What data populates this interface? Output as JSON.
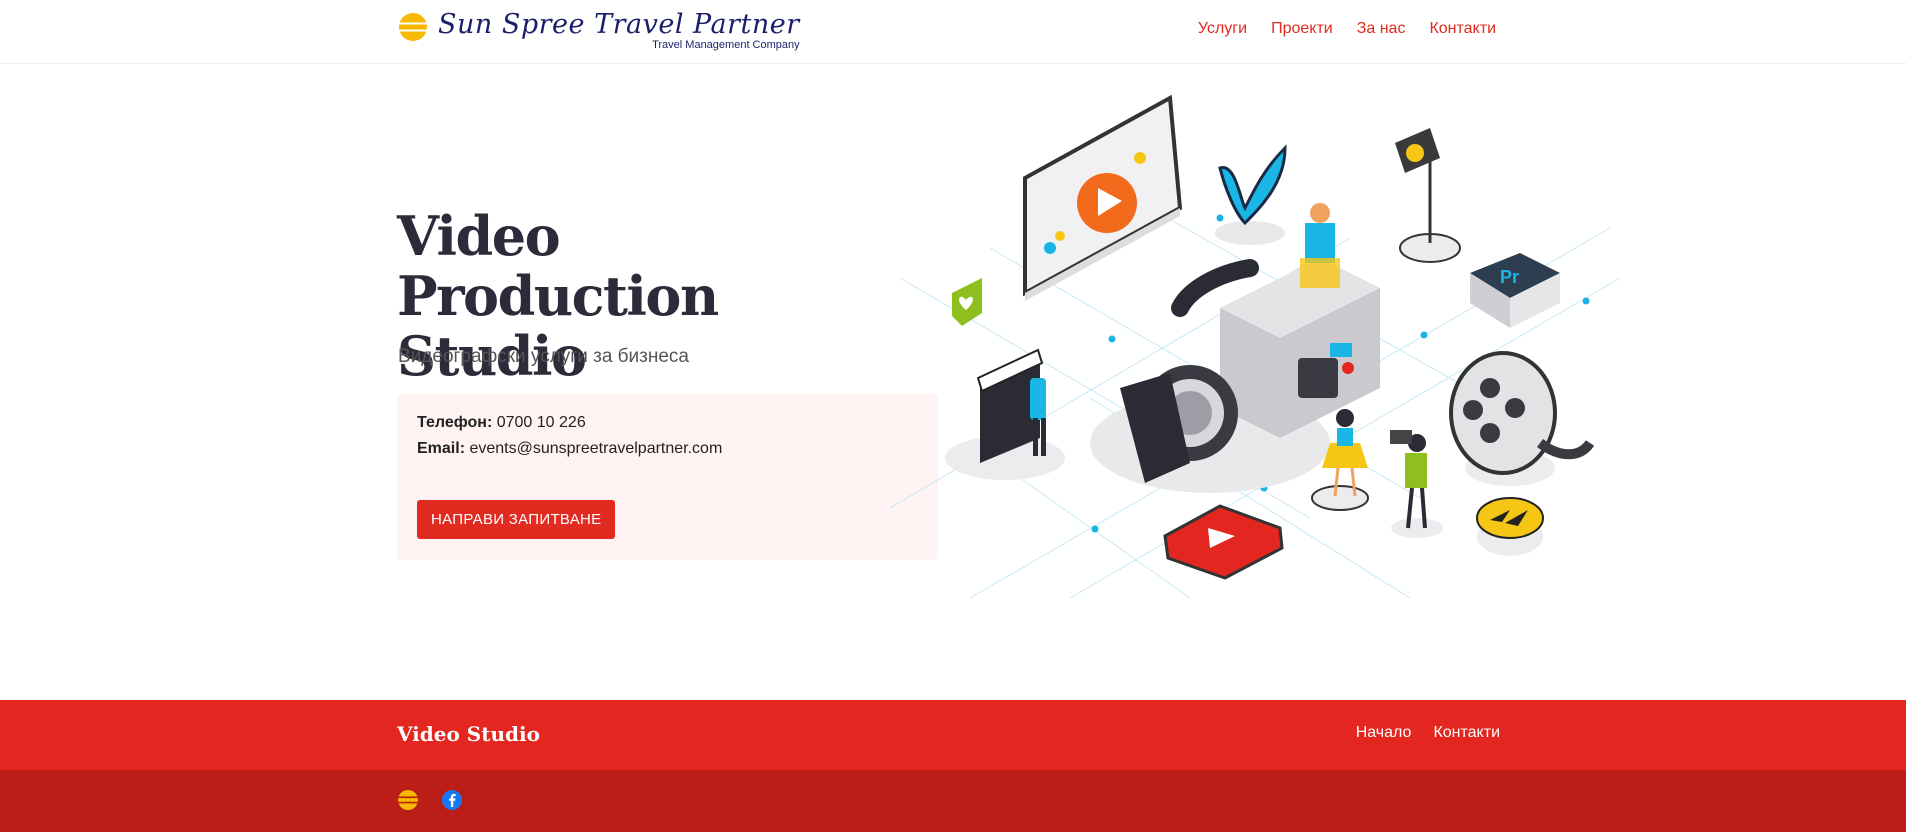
{
  "header": {
    "logo_title": "Sun Spree Travel Partner",
    "logo_subtitle": "Travel Management Company",
    "nav": [
      "Услуги",
      "Проекти",
      "За нас",
      "Контакти"
    ]
  },
  "hero": {
    "title": "Video Production Studio",
    "subtitle": "Видеографски услуги за бизнеса",
    "phone_label": "Телефон:",
    "phone": "0700 10 226",
    "email_label": "Email:",
    "email": "events@sunspreetravelpartner.com",
    "cta_label": "НАПРАВИ ЗАПИТВАНЕ",
    "illustration_icons": [
      "video-screen-icon",
      "vimeo-icon",
      "spotlight-icon",
      "premiere-icon",
      "heart-chat-icon",
      "clapperboard-icon",
      "video-camera-icon",
      "film-reel-icon",
      "youtube-icon",
      "forward-icon"
    ]
  },
  "footer": {
    "brand": "Video Studio",
    "nav": [
      "Начало",
      "Контакти"
    ],
    "icons": [
      "sun-logo-icon",
      "facebook-icon"
    ]
  },
  "colors": {
    "accent": "#e12a20",
    "footer_top": "#e3261f",
    "footer_bottom": "#bb1d17",
    "logo_navy": "#1b1f6b",
    "contact_bg": "#fff3f3"
  }
}
